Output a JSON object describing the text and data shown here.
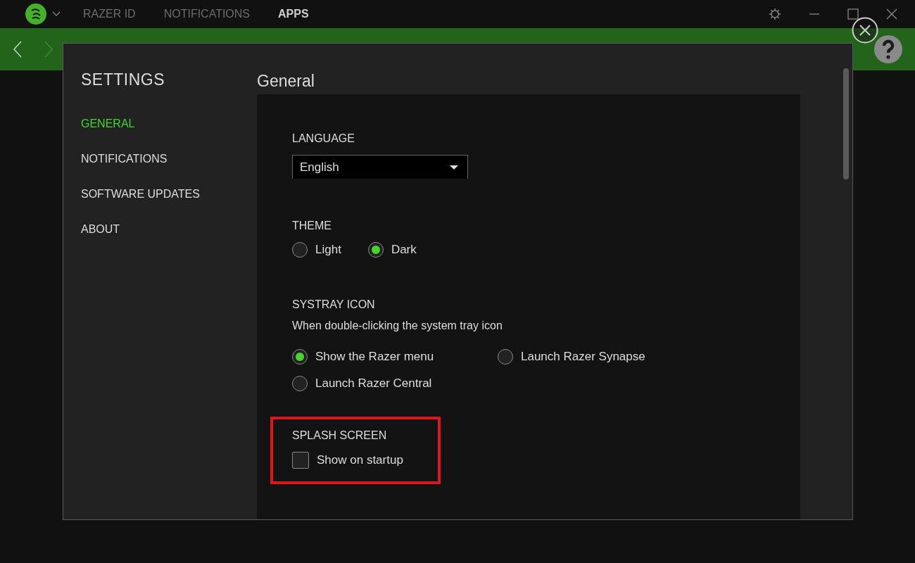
{
  "titlebar": {
    "tabs": [
      {
        "label": "RAZER ID",
        "selected": false
      },
      {
        "label": "NOTIFICATIONS",
        "selected": false
      },
      {
        "label": "APPS",
        "selected": true
      }
    ]
  },
  "settings": {
    "title": "SETTINGS",
    "heading": "General",
    "nav": [
      {
        "label": "GENERAL",
        "selected": true
      },
      {
        "label": "NOTIFICATIONS",
        "selected": false
      },
      {
        "label": "SOFTWARE UPDATES",
        "selected": false
      },
      {
        "label": "ABOUT",
        "selected": false
      }
    ],
    "sections": [
      {
        "kind": "dropdown",
        "label": "LANGUAGE",
        "value": "English",
        "highlighted": false
      },
      {
        "kind": "radios",
        "label": "THEME",
        "highlighted": false,
        "options": [
          {
            "label": "Light",
            "selected": false
          },
          {
            "label": "Dark",
            "selected": true
          }
        ]
      },
      {
        "kind": "radios",
        "label": "SYSTRAY ICON",
        "description": "When double-clicking the system tray icon",
        "highlighted": false,
        "options": [
          {
            "label": "Show the Razer menu",
            "selected": true
          },
          {
            "label": "Launch Razer Synapse",
            "selected": false
          },
          {
            "label": "Launch Razer Central",
            "selected": false
          }
        ]
      },
      {
        "kind": "checkbox",
        "label": "SPLASH SCREEN",
        "highlighted": true,
        "options": [
          {
            "label": "Show on startup",
            "checked": false
          }
        ]
      }
    ]
  }
}
